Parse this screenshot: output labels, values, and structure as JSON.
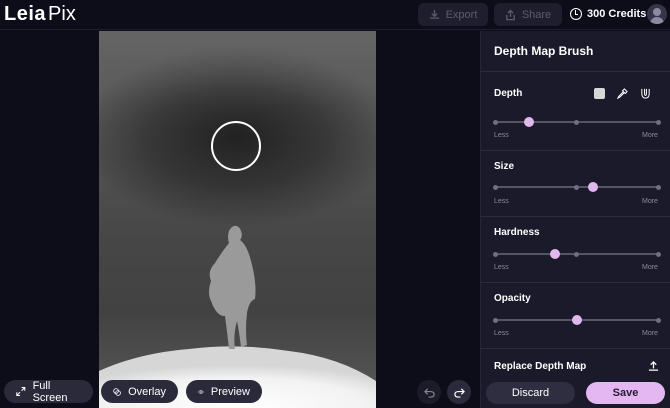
{
  "app": {
    "logo_main": "Leia",
    "logo_sub": "Pix"
  },
  "toolbar": {
    "export_label": "Export",
    "share_label": "Share",
    "credits_label": "300 Credits",
    "export_icon": "download-icon",
    "share_icon": "share-icon",
    "credits_icon": "clock-icon"
  },
  "canvas": {
    "fullscreen_label": "Full Screen",
    "overlay_label": "Overlay",
    "preview_label": "Preview"
  },
  "panel": {
    "title": "Depth Map Brush",
    "sections": [
      {
        "label": "Depth",
        "value": 0.21
      },
      {
        "label": "Size",
        "value": 0.6
      },
      {
        "label": "Hardness",
        "value": 0.37
      },
      {
        "label": "Opacity",
        "value": 0.5
      }
    ],
    "less_label": "Less",
    "more_label": "More",
    "replace_label": "Replace Depth Map",
    "discard_label": "Discard",
    "save_label": "Save"
  },
  "colors": {
    "accent": "#e4b6f2",
    "background": "#0d0d1a",
    "panel": "#1a1a2a"
  }
}
